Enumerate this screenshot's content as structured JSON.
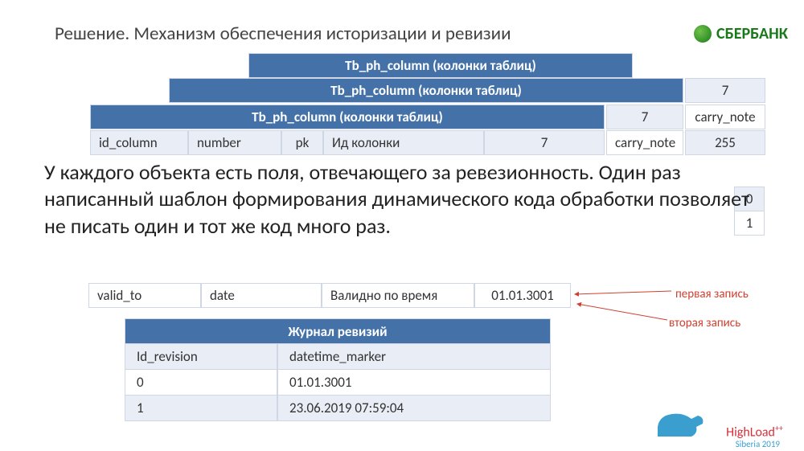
{
  "title": "Решение. Механизм обеспечения историзации и ревизии",
  "bank_name": "СБЕРБАНК",
  "stack": {
    "header_text": "Tb_ph_column (колонки таблиц)",
    "side_7": "7",
    "side_carry": "carry_note",
    "side_255": "255",
    "side_0": "0",
    "side_1": "1"
  },
  "col_row": {
    "c1": "id_column",
    "c2": "number",
    "c3": "pk",
    "c4": "Ид колонки",
    "c5": "7",
    "c6": "carry_note"
  },
  "paragraph": "У каждого объекта есть поля, отвечающего за ревезионность. Один раз написанный шаблон формирования динамического кода обработки позволяет не писать один и тот же код много раз.",
  "valid_row": {
    "c1": "valid_to",
    "c2": "date",
    "c3": "Валидно по время",
    "c4": "01.01.3001"
  },
  "annotations": {
    "first": "первая запись",
    "second": "вторая запись"
  },
  "revision_table": {
    "header": "Журнал ревизий",
    "col1": "Id_revision",
    "col2": "datetime_marker",
    "rows": [
      {
        "id": "0",
        "dt": "01.01.3001"
      },
      {
        "id": "1",
        "dt": "23.06.2019 07:59:04"
      }
    ]
  },
  "brand": {
    "name": "HighLoad",
    "sub": "Siberia 2019"
  }
}
